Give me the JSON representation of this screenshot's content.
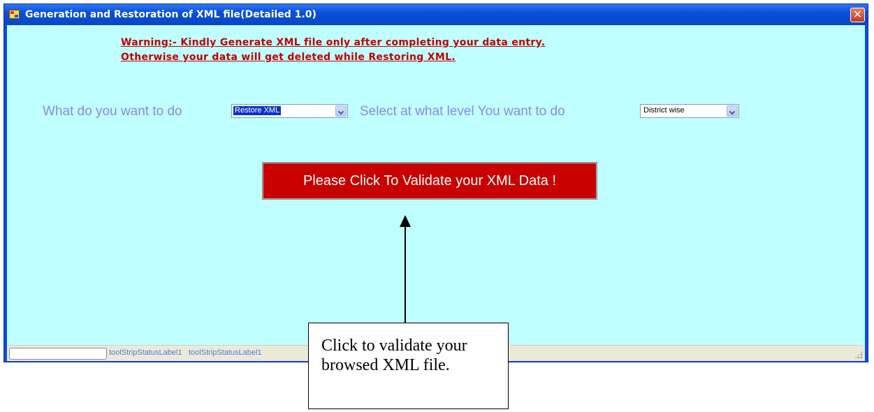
{
  "window": {
    "title": "Generation and Restoration of XML file(Detailed 1.0)",
    "close_glyph": "✕",
    "icons": [
      "app-icon",
      "close-icon"
    ]
  },
  "warning": {
    "line1": "Warning:- Kindly Generate XML file only after completing your data entry.",
    "line2": "Otherwise your data will get deleted while Restoring XML."
  },
  "form": {
    "action_label": "What do you want to do",
    "action_value": "Restore XML",
    "level_label": "Select at what level You want to do",
    "level_value": "District wise"
  },
  "validate_button": {
    "label": "Please Click To Validate your XML Data !"
  },
  "statusbar": {
    "label1": "toolStripStatusLabel1",
    "label2": "toolStripStatusLabel1"
  },
  "callout": {
    "text": "Click to validate your browsed XML file."
  },
  "colors": {
    "client_background": "#c0ffff",
    "warning_text": "#c00000",
    "label_text": "#8a8ae0",
    "button_background": "#c80000",
    "titlebar": "#0a4fd8"
  }
}
